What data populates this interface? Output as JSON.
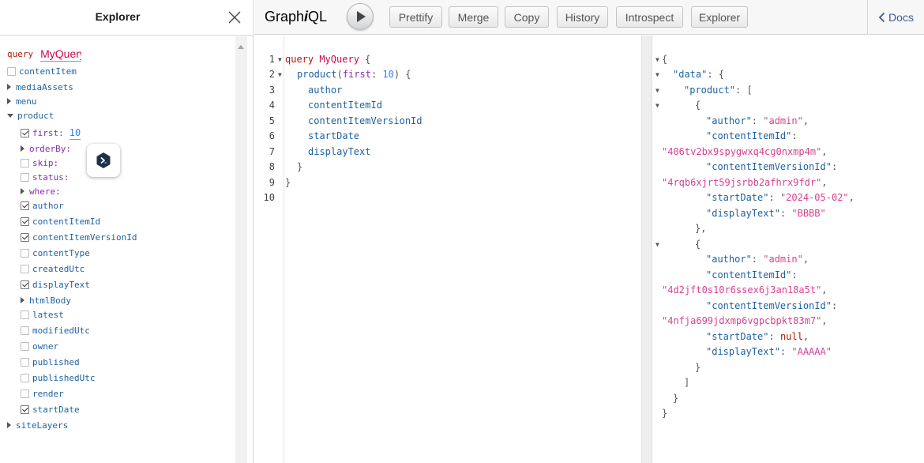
{
  "explorer": {
    "title": "Explorer",
    "operation_keyword": "query",
    "operation_name": "MyQuery",
    "root_fields": [
      {
        "label": "contentItem"
      },
      {
        "label": "mediaAssets"
      },
      {
        "label": "menu"
      },
      {
        "label": "product"
      },
      {
        "label": "siteLayers"
      }
    ],
    "product_args": [
      {
        "label": "first:",
        "value": "10",
        "checked": true
      },
      {
        "label": "orderBy:"
      },
      {
        "label": "skip:",
        "checked": false
      },
      {
        "label": "status:",
        "checked": false
      },
      {
        "label": "where:"
      }
    ],
    "product_fields": [
      {
        "label": "author",
        "checked": true
      },
      {
        "label": "contentItemId",
        "checked": true
      },
      {
        "label": "contentItemVersionId",
        "checked": true
      },
      {
        "label": "contentType",
        "checked": false
      },
      {
        "label": "createdUtc",
        "checked": false
      },
      {
        "label": "displayText",
        "checked": true
      },
      {
        "label": "htmlBody"
      },
      {
        "label": "latest",
        "checked": false
      },
      {
        "label": "modifiedUtc",
        "checked": false
      },
      {
        "label": "owner",
        "checked": false
      },
      {
        "label": "published",
        "checked": false
      },
      {
        "label": "publishedUtc",
        "checked": false
      },
      {
        "label": "render",
        "checked": false
      },
      {
        "label": "startDate",
        "checked": true
      }
    ]
  },
  "toolbar": {
    "logo_prefix": "Graph",
    "logo_italic": "i",
    "logo_suffix": "QL",
    "prettify": "Prettify",
    "merge": "Merge",
    "copy": "Copy",
    "history": "History",
    "introspect": "Introspect",
    "explorer": "Explorer",
    "docs": "Docs"
  },
  "query_editor": {
    "line_numbers": [
      "1",
      "2",
      "3",
      "4",
      "5",
      "6",
      "7",
      "8",
      "9",
      "10"
    ],
    "l1_kw": "query",
    "l1_name": "MyQuery",
    "l1_brace": "{",
    "l2_field": "product",
    "l2_open": "(",
    "l2_arg": "first",
    "l2_colon": ": ",
    "l2_value": "10",
    "l2_close": ") {",
    "fields": [
      "author",
      "contentItemId",
      "contentItemVersionId",
      "startDate",
      "displayText"
    ],
    "close_inner": "}",
    "close_outer": "}"
  },
  "result": {
    "open_brace": "{",
    "data_key": "\"data\"",
    "product_key": "\"product\"",
    "items": [
      {
        "author": "\"admin\"",
        "contentItemId": "\"406tv2bx9spygwxq4cg0nxmp4m\"",
        "contentItemVersionId": "\"4rqb6xjrt59jsrbb2afhrx9fdr\"",
        "startDate": "\"2024-05-02\"",
        "displayText": "\"BBBB\""
      },
      {
        "author": "\"admin\"",
        "contentItemId": "\"4d2jft0s10r6ssex6j3an18a5t\"",
        "contentItemVersionId": "\"4nfja699jdxmp6vgpcbpkt83m7\"",
        "startDate": "null",
        "displayText": "\"AAAAA\""
      }
    ],
    "keys": {
      "author": "\"author\"",
      "contentItemId": "\"contentItemId\"",
      "contentItemVersionId": "\"contentItemVersionId\"",
      "startDate": "\"startDate\"",
      "displayText": "\"displayText\""
    }
  },
  "colors": {
    "keyword": "#b11a04",
    "def": "#d2054e",
    "field": "#1f61a0",
    "argument": "#8b2bb9",
    "number": "#2882f9",
    "string": "#d64292",
    "docs_link": "#3b5998"
  },
  "icons": {
    "close": "close-icon",
    "run": "play-icon",
    "docs": "chevron-left-icon",
    "extension": "extension-icon"
  }
}
